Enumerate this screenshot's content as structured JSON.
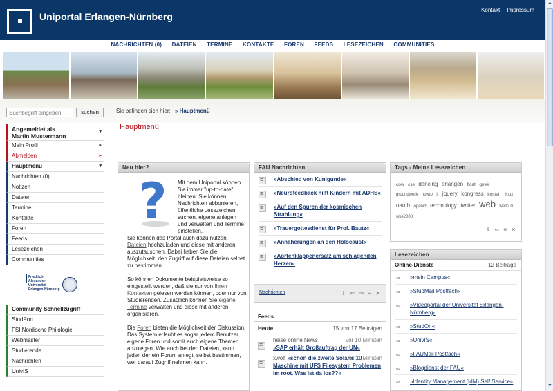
{
  "header": {
    "title": "Uniportal Erlangen-Nürnberg",
    "links": [
      "Kontakt",
      "Impressum"
    ]
  },
  "nav": [
    "NACHRICHTEN (0)",
    "DATEIEN",
    "TERMINE",
    "KONTAKTE",
    "FOREN",
    "FEEDS",
    "LESEZEICHEN",
    "COMMUNITIES"
  ],
  "search": {
    "placeholder": "Suchbegriff eingeben",
    "button": "suchen"
  },
  "breadcrumb": {
    "prefix": "Sie befinden sich hier:",
    "current": "» Hauptmenü"
  },
  "menu": {
    "user_label": "Angemeldet als",
    "user_name": "Martin Mustermann",
    "profile": "Mein Profil",
    "logout": "Abmelden",
    "main": "Hauptmenü",
    "items": [
      "Nachrichten (0)",
      "Notizen",
      "Dateien",
      "Termine",
      "Kontakte",
      "Foren",
      "Feeds",
      "Lesezeichen",
      "Communities"
    ]
  },
  "logo": {
    "text": "Friedrich-Alexander-Universität Erlangen-Nürnberg"
  },
  "community": {
    "title": "Community Schnellzugriff",
    "items": [
      "StudPort",
      "FSI Nordische Philologie",
      "Webmaster",
      "Studierende",
      "Nachrichten",
      "UnivIS"
    ]
  },
  "main": {
    "title": "Hauptmenü"
  },
  "neu_hier": {
    "title": "Neu hier?",
    "p1_a": "Mit dem Uniportal können Sie immer \"up-to-date\" bleiben: Sie können Nachrichten abbonieren, öffentliche Lesezeichen suchen, eigene anlegen und verwalten und Termine einstellen.",
    "p1_b": "Sie können das Portal auch dazu nutzen,",
    "p1_link": "Dateien",
    "p1_c": "hochzuladen und diese mit anderen auszutauschen. Dabei haben Sie die Möglichkeit, den Zugriff auf diese Dateien selbst zu bestimmen.",
    "p2_a": "So können Dokumente beispielsweise so eingestellt werden, daß sie nur von",
    "p2_link1": "Ihren Kontakten",
    "p2_b": "gelesen werden können, oder nur von Studierenden. Zusätzlich können Sie",
    "p2_link2": "eigene Termine",
    "p2_c": "verwalten und diese mit anderen organisieren.",
    "p3_a": "Die",
    "p3_link": "Foren",
    "p3_b": "bieten die Möglichkeit der Diskussion.",
    "p3_c": "Das System erlaubt es sogar jedem Benutzer eigene Foren und somit auch eigene Themen anzulegen. Wie auch bei den Dateien, kann jeder, der ein Forum anlegt, selbst bestimmen, wer darauf Zugriff nehmen kann."
  },
  "fau_news": {
    "title": "FAU Nachrichten",
    "items": [
      "»Abschied von Kunigunde«",
      "»Neurofeedback hilft Kindern mit ADHS«",
      "»Auf den Spuren der kosmischen Strahlung«",
      "»Trauergottesdienst für Prof. Bautz«",
      "»Annäherungen an den Holocaust«",
      "»Aortenklappenersatz am schlagenden Herzen«"
    ],
    "footer_link": "Nachrichten",
    "controls": "⇓ ⇐ ⇒ ≡ ✕"
  },
  "feeds": {
    "title": "Feeds",
    "today": "Heute",
    "count": "15 von 17 Beiträgen",
    "items": [
      {
        "source": "heise online News",
        "time": "vor 10 Minuten",
        "text": "»SAP erhält Großauftrag der UN«"
      },
      {
        "source": "xwolf",
        "time": "vor 11 Minuten",
        "text": "»schon die zweite Solaris 10 Maschine mit UFS Filesystem Problemen im root. Was ist da los??«"
      }
    ]
  },
  "tags": {
    "title": "Tags - Meine Lesezeichen",
    "items": [
      {
        "t": "cow",
        "s": 6.5
      },
      {
        "t": "css",
        "s": 6.5
      },
      {
        "t": "dancing",
        "s": 8
      },
      {
        "t": "erlangen",
        "s": 8
      },
      {
        "t": "float",
        "s": 6.5
      },
      {
        "t": "geek",
        "s": 6.5
      },
      {
        "t": "groundwork",
        "s": 6
      },
      {
        "t": "howto",
        "s": 6
      },
      {
        "t": "it",
        "s": 6
      },
      {
        "t": "jquery",
        "s": 8
      },
      {
        "t": "kongress",
        "s": 8
      },
      {
        "t": "kosten",
        "s": 6.5
      },
      {
        "t": "linux",
        "s": 6
      },
      {
        "t": "oauth",
        "s": 8
      },
      {
        "t": "openid",
        "s": 6
      },
      {
        "t": "technology",
        "s": 8
      },
      {
        "t": "twitter",
        "s": 8
      },
      {
        "t": "web",
        "s": 13
      },
      {
        "t": "web2.0",
        "s": 6
      },
      {
        "t": "wke2008",
        "s": 6
      }
    ],
    "controls": "⇓ ⇐ ≡ ✕"
  },
  "bookmarks": {
    "title": "Lesezeichen",
    "group": "Online-Dienste",
    "count": "12 Beiträge",
    "items": [
      "»mein Campus«",
      "»StudMail Postfach«",
      "»Videoportal der Universität Erlangen-Nürnberg«",
      "»StudOn«",
      "»UnivIS«",
      "»FAUMail Postfach«",
      "»Blogdienst der FAU«",
      "»Identity Management (IdM) Self Service«"
    ]
  },
  "colors": {
    "header": "#0b3668",
    "accent_red": "#b5121b",
    "link": "#1a3a6e",
    "green": "#2e7d32"
  }
}
